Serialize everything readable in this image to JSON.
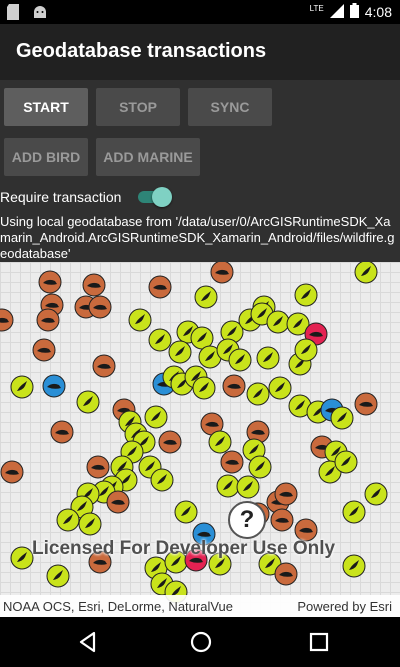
{
  "status_bar": {
    "time": "4:08",
    "network": "LTE"
  },
  "app_bar": {
    "title": "Geodatabase transactions"
  },
  "buttons": {
    "start": "START",
    "stop": "STOP",
    "sync": "SYNC",
    "add_bird": "ADD BIRD",
    "add_marine": "ADD MARINE"
  },
  "toggle": {
    "label": "Require transaction",
    "checked": true
  },
  "info_text": "Using local geodatabase from '/data/user/0/ArcGISRuntimeSDK_Xamarin_Android.ArcGISRuntimeSDK_Xamarin_Android/files/wildfire.geodatabase'",
  "map": {
    "watermark": "Licensed For Developer Use Only",
    "identify_button": "?",
    "attribution_left": "NOAA OCS, Esri, DeLorme, NaturalVue",
    "attribution_right": "Powered by Esri"
  },
  "colors": {
    "bird": "#c9e31b",
    "marine": "#c96a3d",
    "blue": "#2a8fd6",
    "red": "#e32252",
    "accent": "#7fd1c3"
  }
}
